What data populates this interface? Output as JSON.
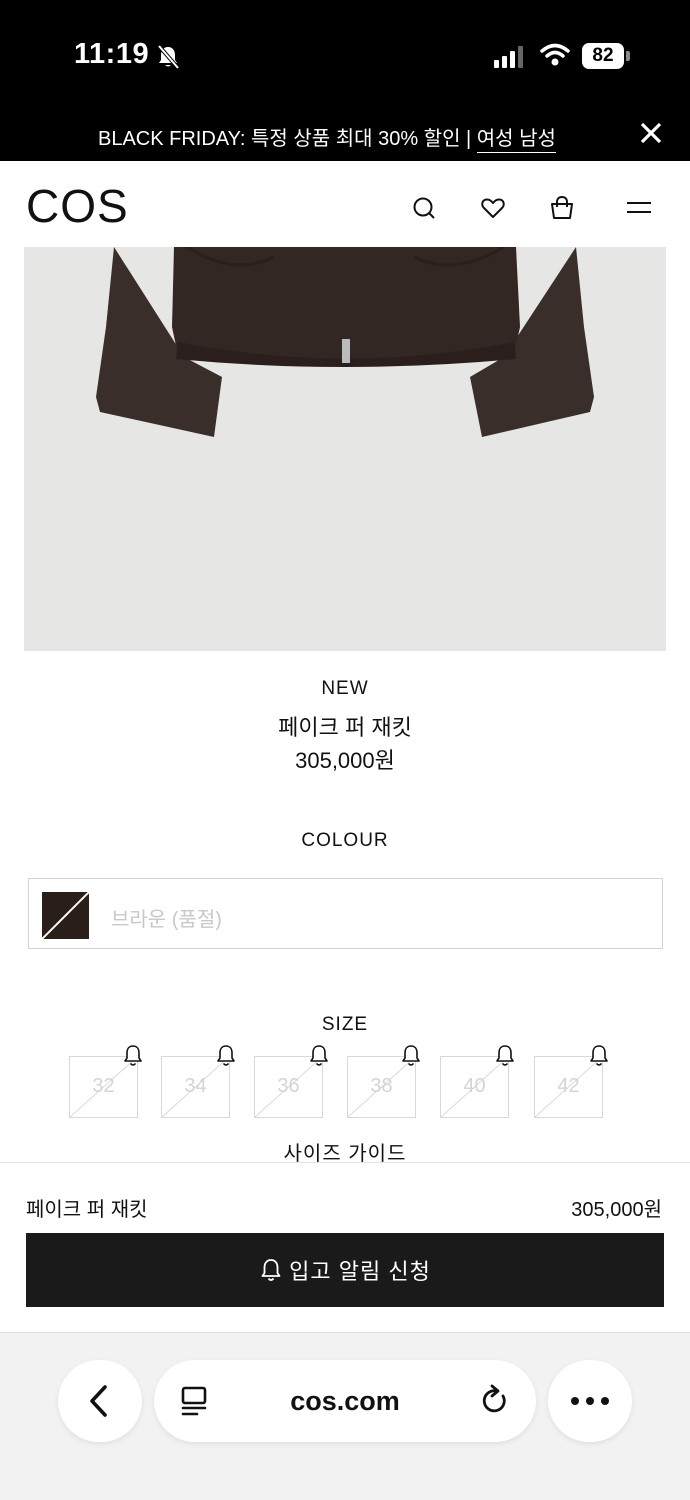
{
  "status_bar": {
    "time": "11:19",
    "battery": "82"
  },
  "promo": {
    "text": "BLACK FRIDAY: 특정 상품 최대 30% 할인 | ",
    "link": "여성 남성"
  },
  "header": {
    "logo": "COS"
  },
  "product": {
    "badge": "NEW",
    "name": "페이크 퍼 재킷",
    "price": "305,000원"
  },
  "colour": {
    "heading": "COLOUR",
    "selected_label": "브라운 (품절)",
    "swatch_color": "#2a1e19"
  },
  "size": {
    "heading": "SIZE",
    "options": [
      "32",
      "34",
      "36",
      "38",
      "40",
      "42"
    ],
    "guide_label": "사이즈 가이드"
  },
  "buy_bar": {
    "name": "페이크 퍼 재킷",
    "price": "305,000원",
    "button_label": "입고 알림 신청"
  },
  "browser": {
    "url": "cos.com"
  },
  "colors": {
    "accent": "#1a1a1a",
    "banner": "#000000",
    "image_bg": "#e6e6e4"
  }
}
